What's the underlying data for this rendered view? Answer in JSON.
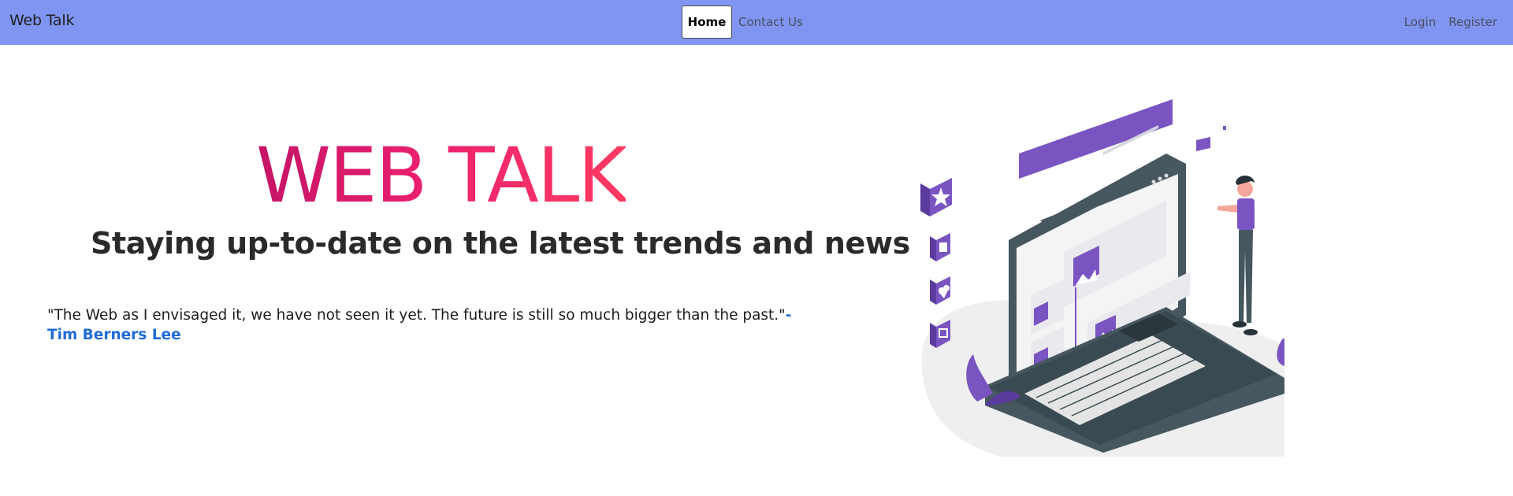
{
  "navbar": {
    "brand": "Web Talk",
    "home_label": "Home",
    "contact_label": "Contact Us",
    "login_label": "Login",
    "register_label": "Register"
  },
  "hero": {
    "title": "WEB TALK",
    "subtitle": "Staying up-to-date on the latest trends and news",
    "quote_text": "\"The Web as I envisaged it, we have not seen it yet. The future is still so much bigger than the past.\"",
    "quote_author": "-Tim Berners Lee"
  },
  "illustration": {
    "icon_names": [
      "star-icon",
      "thumbs-up-icon",
      "heart-icon",
      "image-icon"
    ]
  },
  "colors": {
    "navbar_bg": "#7f95f1",
    "title_gradient_start": "#c51466",
    "title_gradient_end": "#ff3a61",
    "author_link": "#1f6bd6",
    "illustration_purple": "#7a55c2",
    "laptop_dark": "#465760"
  }
}
